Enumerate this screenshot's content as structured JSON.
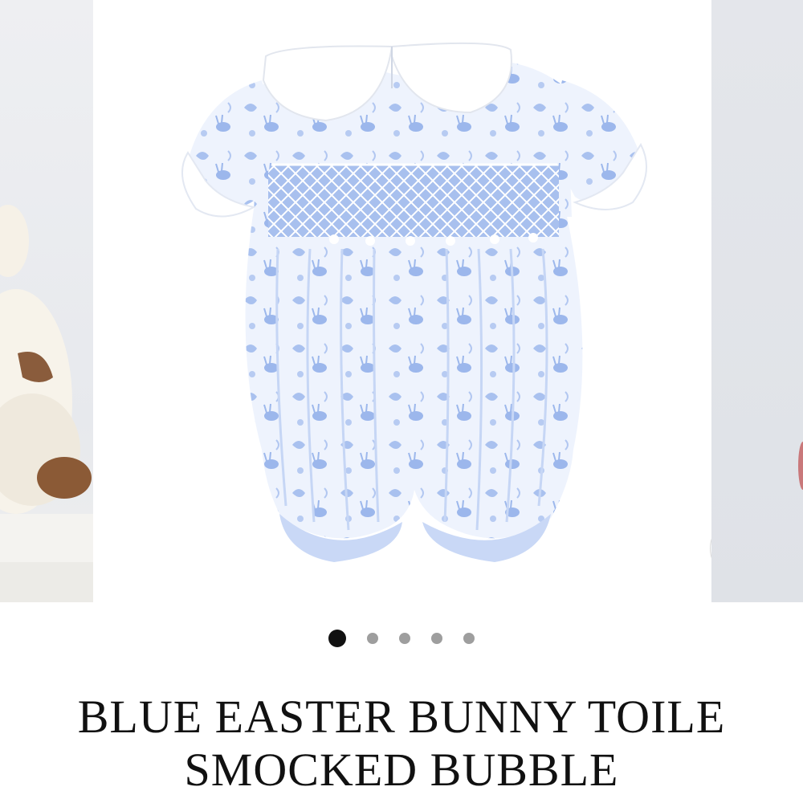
{
  "gallery": {
    "dots": [
      {
        "active": true
      },
      {
        "active": false
      },
      {
        "active": false
      },
      {
        "active": false
      },
      {
        "active": false
      }
    ],
    "zoom_icon": "magnifier-icon"
  },
  "product": {
    "title_line1": "BLUE EASTER BUNNY TOILE",
    "title_line2": "SMOCKED BUBBLE"
  },
  "colors": {
    "toile_blue": "#8fb0e6",
    "fabric_white": "#f3f6fd",
    "active_dot": "#111111",
    "inactive_dot": "#9e9e9e"
  }
}
